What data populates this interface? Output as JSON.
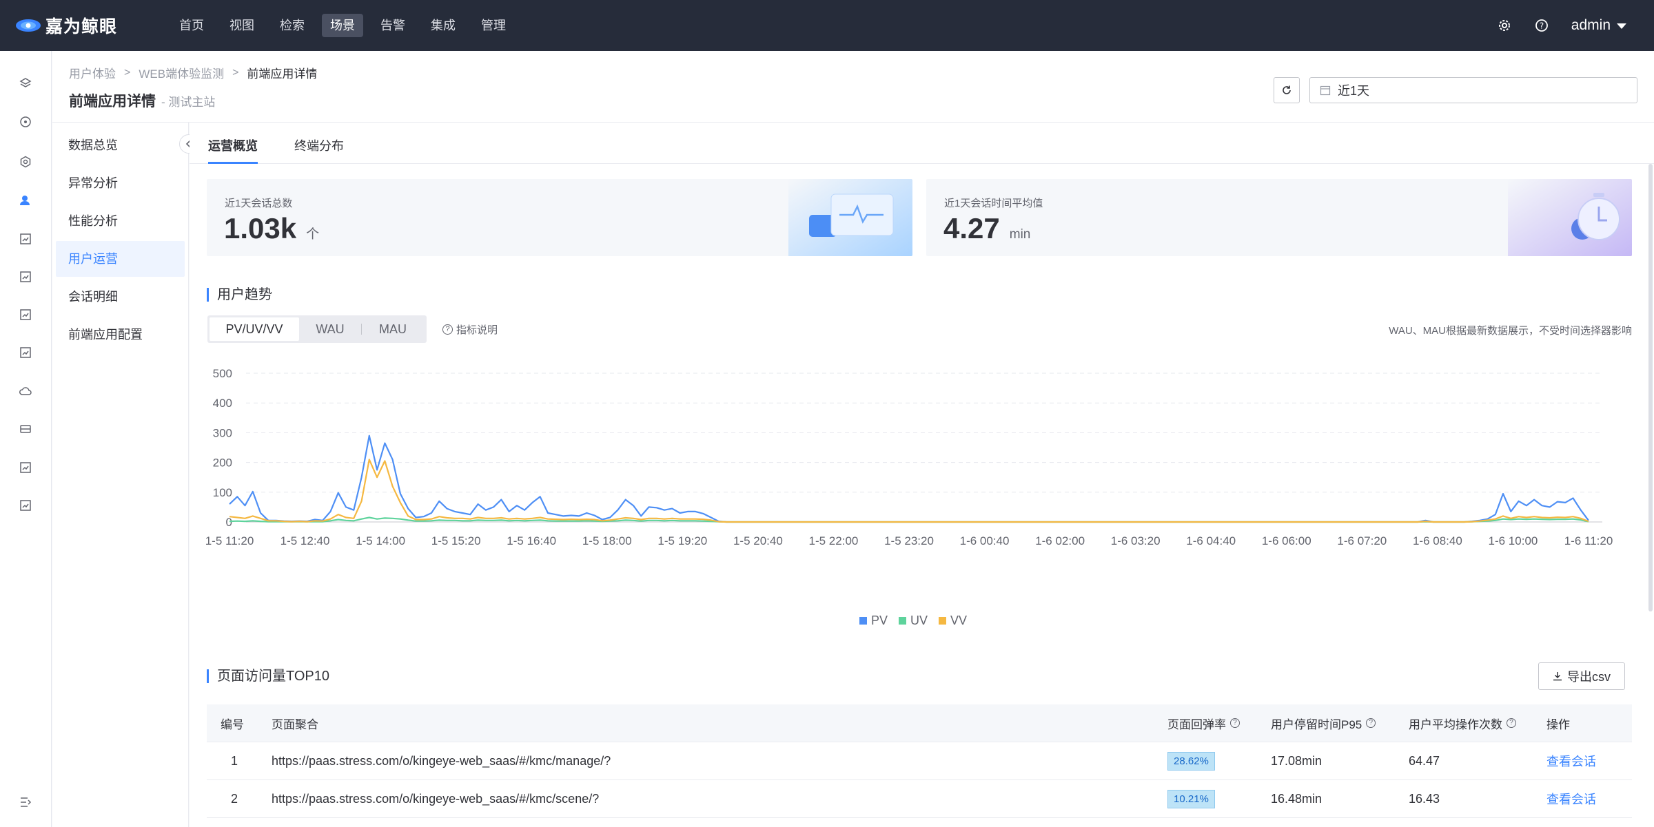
{
  "app": {
    "name": "嘉为鲸眼"
  },
  "nav": {
    "items": [
      "首页",
      "视图",
      "检索",
      "场景",
      "告警",
      "集成",
      "管理"
    ],
    "active_index": 3
  },
  "user": {
    "name": "admin"
  },
  "rail": {
    "icons": [
      "layers-icon",
      "compass-icon",
      "hexagon-icon",
      "user-icon",
      "chart-icon",
      "chart-icon",
      "chart-icon",
      "chart-icon",
      "cloud-icon",
      "storage-icon",
      "chart-icon",
      "chart-icon"
    ],
    "active_index": 3,
    "bottom_icon": "expand-menu-icon"
  },
  "breadcrumb": [
    "用户体验",
    "WEB端体验监测",
    "前端应用详情"
  ],
  "page": {
    "title": "前端应用详情",
    "subtitle": "- 测试主站"
  },
  "time_range": {
    "value": "近1天"
  },
  "submenu": {
    "items": [
      "数据总览",
      "异常分析",
      "性能分析",
      "用户运营",
      "会话明细",
      "前端应用配置"
    ],
    "active_index": 3
  },
  "tabs": [
    "运营概览",
    "终端分布"
  ],
  "stats": {
    "sessions": {
      "label": "近1天会话总数",
      "value": "1.03k",
      "unit": "个"
    },
    "avg_duration": {
      "label": "近1天会话时间平均值",
      "value": "4.27",
      "unit": "min"
    }
  },
  "trend": {
    "title": "用户趋势",
    "segments": [
      "PV/UV/VV",
      "WAU",
      "MAU"
    ],
    "active_segment": 0,
    "help": "指标说明",
    "note": "WAU、MAU根据最新数据展示，不受时间选择器影响"
  },
  "chart_data": {
    "type": "line",
    "ylim": [
      0,
      500
    ],
    "yticks": [
      0,
      100,
      200,
      300,
      400,
      500
    ],
    "xticks": [
      "1-5 11:20",
      "1-5 12:40",
      "1-5 14:00",
      "1-5 15:20",
      "1-5 16:40",
      "1-5 18:00",
      "1-5 19:20",
      "1-5 20:40",
      "1-5 22:00",
      "1-5 23:20",
      "1-6 00:40",
      "1-6 02:00",
      "1-6 03:20",
      "1-6 04:40",
      "1-6 06:00",
      "1-6 07:20",
      "1-6 08:40",
      "1-6 10:00",
      "1-6 11:20"
    ],
    "legend_position": "bottom",
    "series": [
      {
        "name": "PV",
        "color": "#4e8ff5",
        "values": [
          60,
          85,
          55,
          102,
          30,
          5,
          5,
          3,
          2,
          3,
          2,
          8,
          5,
          35,
          98,
          50,
          40,
          150,
          290,
          175,
          265,
          210,
          95,
          45,
          15,
          18,
          30,
          70,
          45,
          35,
          30,
          25,
          60,
          40,
          50,
          75,
          35,
          55,
          40,
          65,
          85,
          30,
          25,
          20,
          22,
          20,
          30,
          22,
          8,
          15,
          40,
          75,
          55,
          20,
          50,
          48,
          40,
          45,
          30,
          35,
          35,
          28,
          15,
          2,
          0,
          0,
          0,
          0,
          0,
          0,
          0,
          0,
          0,
          0,
          0,
          0,
          0,
          0,
          0,
          0,
          0,
          0,
          0,
          0,
          0,
          0,
          0,
          0,
          0,
          0,
          0,
          0,
          0,
          0,
          0,
          0,
          0,
          0,
          0,
          0,
          0,
          0,
          0,
          0,
          0,
          0,
          0,
          0,
          0,
          0,
          0,
          0,
          0,
          0,
          0,
          0,
          0,
          0,
          0,
          0,
          0,
          0,
          0,
          0,
          0,
          0,
          0,
          0,
          0,
          0,
          0,
          0,
          0,
          0,
          0,
          0,
          0,
          0,
          0,
          0,
          0,
          0,
          0,
          0,
          0,
          0,
          0,
          0,
          0,
          0,
          0,
          0,
          0,
          0,
          5,
          0,
          0,
          0,
          0,
          0,
          2,
          5,
          10,
          25,
          95,
          35,
          70,
          55,
          75,
          55,
          50,
          68,
          65,
          80,
          40,
          5
        ]
      },
      {
        "name": "UV",
        "color": "#5ed39c",
        "values": [
          2,
          3,
          2,
          4,
          2,
          1,
          1,
          1,
          1,
          1,
          1,
          1,
          1,
          4,
          8,
          5,
          4,
          10,
          15,
          10,
          13,
          12,
          10,
          6,
          3,
          3,
          4,
          6,
          5,
          5,
          4,
          4,
          6,
          5,
          5,
          6,
          4,
          5,
          4,
          5,
          6,
          4,
          3,
          3,
          3,
          3,
          4,
          3,
          2,
          3,
          4,
          6,
          5,
          3,
          5,
          5,
          4,
          5,
          4,
          4,
          4,
          3,
          2,
          1,
          0,
          0,
          0,
          0,
          0,
          0,
          0,
          0,
          0,
          0,
          0,
          0,
          0,
          0,
          0,
          0,
          0,
          0,
          0,
          0,
          0,
          0,
          0,
          0,
          0,
          0,
          0,
          0,
          0,
          0,
          0,
          0,
          0,
          0,
          0,
          0,
          0,
          0,
          0,
          0,
          0,
          0,
          0,
          0,
          0,
          0,
          0,
          0,
          0,
          0,
          0,
          0,
          0,
          0,
          0,
          0,
          0,
          0,
          0,
          0,
          0,
          0,
          0,
          0,
          0,
          0,
          0,
          0,
          0,
          0,
          0,
          0,
          0,
          0,
          0,
          0,
          0,
          0,
          0,
          0,
          0,
          0,
          0,
          0,
          0,
          0,
          0,
          0,
          0,
          0,
          1,
          0,
          0,
          0,
          0,
          0,
          1,
          2,
          3,
          5,
          10,
          8,
          10,
          9,
          10,
          9,
          8,
          9,
          9,
          10,
          7,
          1
        ]
      },
      {
        "name": "VV",
        "color": "#f5b841",
        "values": [
          18,
          15,
          12,
          20,
          12,
          4,
          4,
          2,
          1,
          2,
          1,
          4,
          3,
          10,
          25,
          15,
          12,
          70,
          210,
          150,
          205,
          120,
          65,
          20,
          8,
          8,
          10,
          18,
          14,
          12,
          12,
          10,
          15,
          12,
          12,
          14,
          10,
          12,
          10,
          12,
          15,
          10,
          9,
          8,
          9,
          8,
          9,
          8,
          4,
          6,
          10,
          14,
          12,
          8,
          12,
          12,
          10,
          12,
          10,
          10,
          10,
          9,
          6,
          1,
          0,
          0,
          0,
          0,
          0,
          0,
          0,
          0,
          0,
          0,
          0,
          0,
          0,
          0,
          0,
          0,
          0,
          0,
          0,
          0,
          0,
          0,
          0,
          0,
          0,
          0,
          0,
          0,
          0,
          0,
          0,
          0,
          0,
          0,
          0,
          0,
          0,
          0,
          0,
          0,
          0,
          0,
          0,
          0,
          0,
          0,
          0,
          0,
          0,
          0,
          0,
          0,
          0,
          0,
          0,
          0,
          0,
          0,
          0,
          0,
          0,
          0,
          0,
          0,
          0,
          0,
          0,
          0,
          0,
          0,
          0,
          0,
          0,
          0,
          0,
          0,
          0,
          0,
          0,
          0,
          0,
          0,
          0,
          0,
          0,
          0,
          0,
          0,
          0,
          0,
          2,
          0,
          0,
          0,
          0,
          0,
          1,
          3,
          6,
          10,
          20,
          12,
          18,
          15,
          18,
          15,
          14,
          16,
          15,
          18,
          12,
          2
        ]
      }
    ]
  },
  "top10": {
    "title": "页面访问量TOP10",
    "export_label": "导出csv",
    "columns": [
      "编号",
      "页面聚合",
      "页面回弹率",
      "用户停留时间P95",
      "用户平均操作次数",
      "操作"
    ],
    "rows": [
      {
        "no": "1",
        "page": "https://paas.stress.com/o/kingeye-web_saas/#/kmc/manage/?",
        "bounce": "28.62%",
        "stay": "17.08min",
        "ops": "64.47",
        "action": "查看会话"
      },
      {
        "no": "2",
        "page": "https://paas.stress.com/o/kingeye-web_saas/#/kmc/scene/?",
        "bounce": "10.21%",
        "stay": "16.48min",
        "ops": "16.43",
        "action": "查看会话"
      }
    ]
  }
}
